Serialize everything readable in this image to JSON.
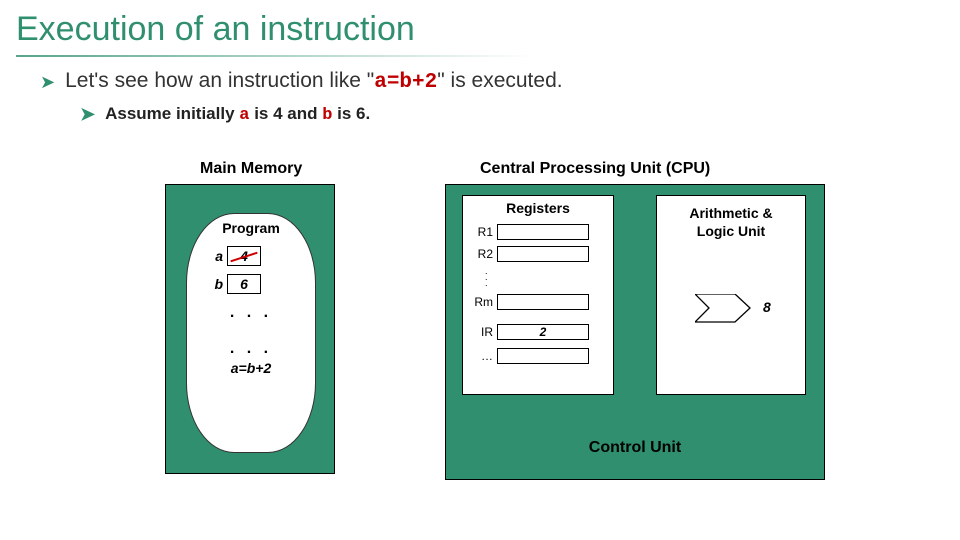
{
  "title": "Execution of an instruction",
  "bullet": {
    "pre": "Let's see how an instruction like \"",
    "code_text": "a=b+2",
    "post": "\" is executed."
  },
  "sub": {
    "t1": "Assume initially ",
    "a": "a",
    "t2": " is 4 and ",
    "b": "b",
    "t3": " is 6."
  },
  "diagram": {
    "mm_title": "Main Memory",
    "cpu_title": "Central Processing Unit (CPU)",
    "program_label": "Program",
    "mem": {
      "a_label": "a",
      "a_value": "4",
      "b_label": "b",
      "b_value": "6",
      "stmt": "a=b+2"
    },
    "dots": ". . .",
    "registers": {
      "title": "Registers",
      "r1": "R1",
      "r2": "R2",
      "rm": "Rm",
      "ir": "IR",
      "ir_value": "2",
      "ell": "…"
    },
    "alu": {
      "title_l1": "Arithmetic &",
      "title_l2": "Logic Unit",
      "output": "8"
    },
    "control": "Control Unit"
  }
}
